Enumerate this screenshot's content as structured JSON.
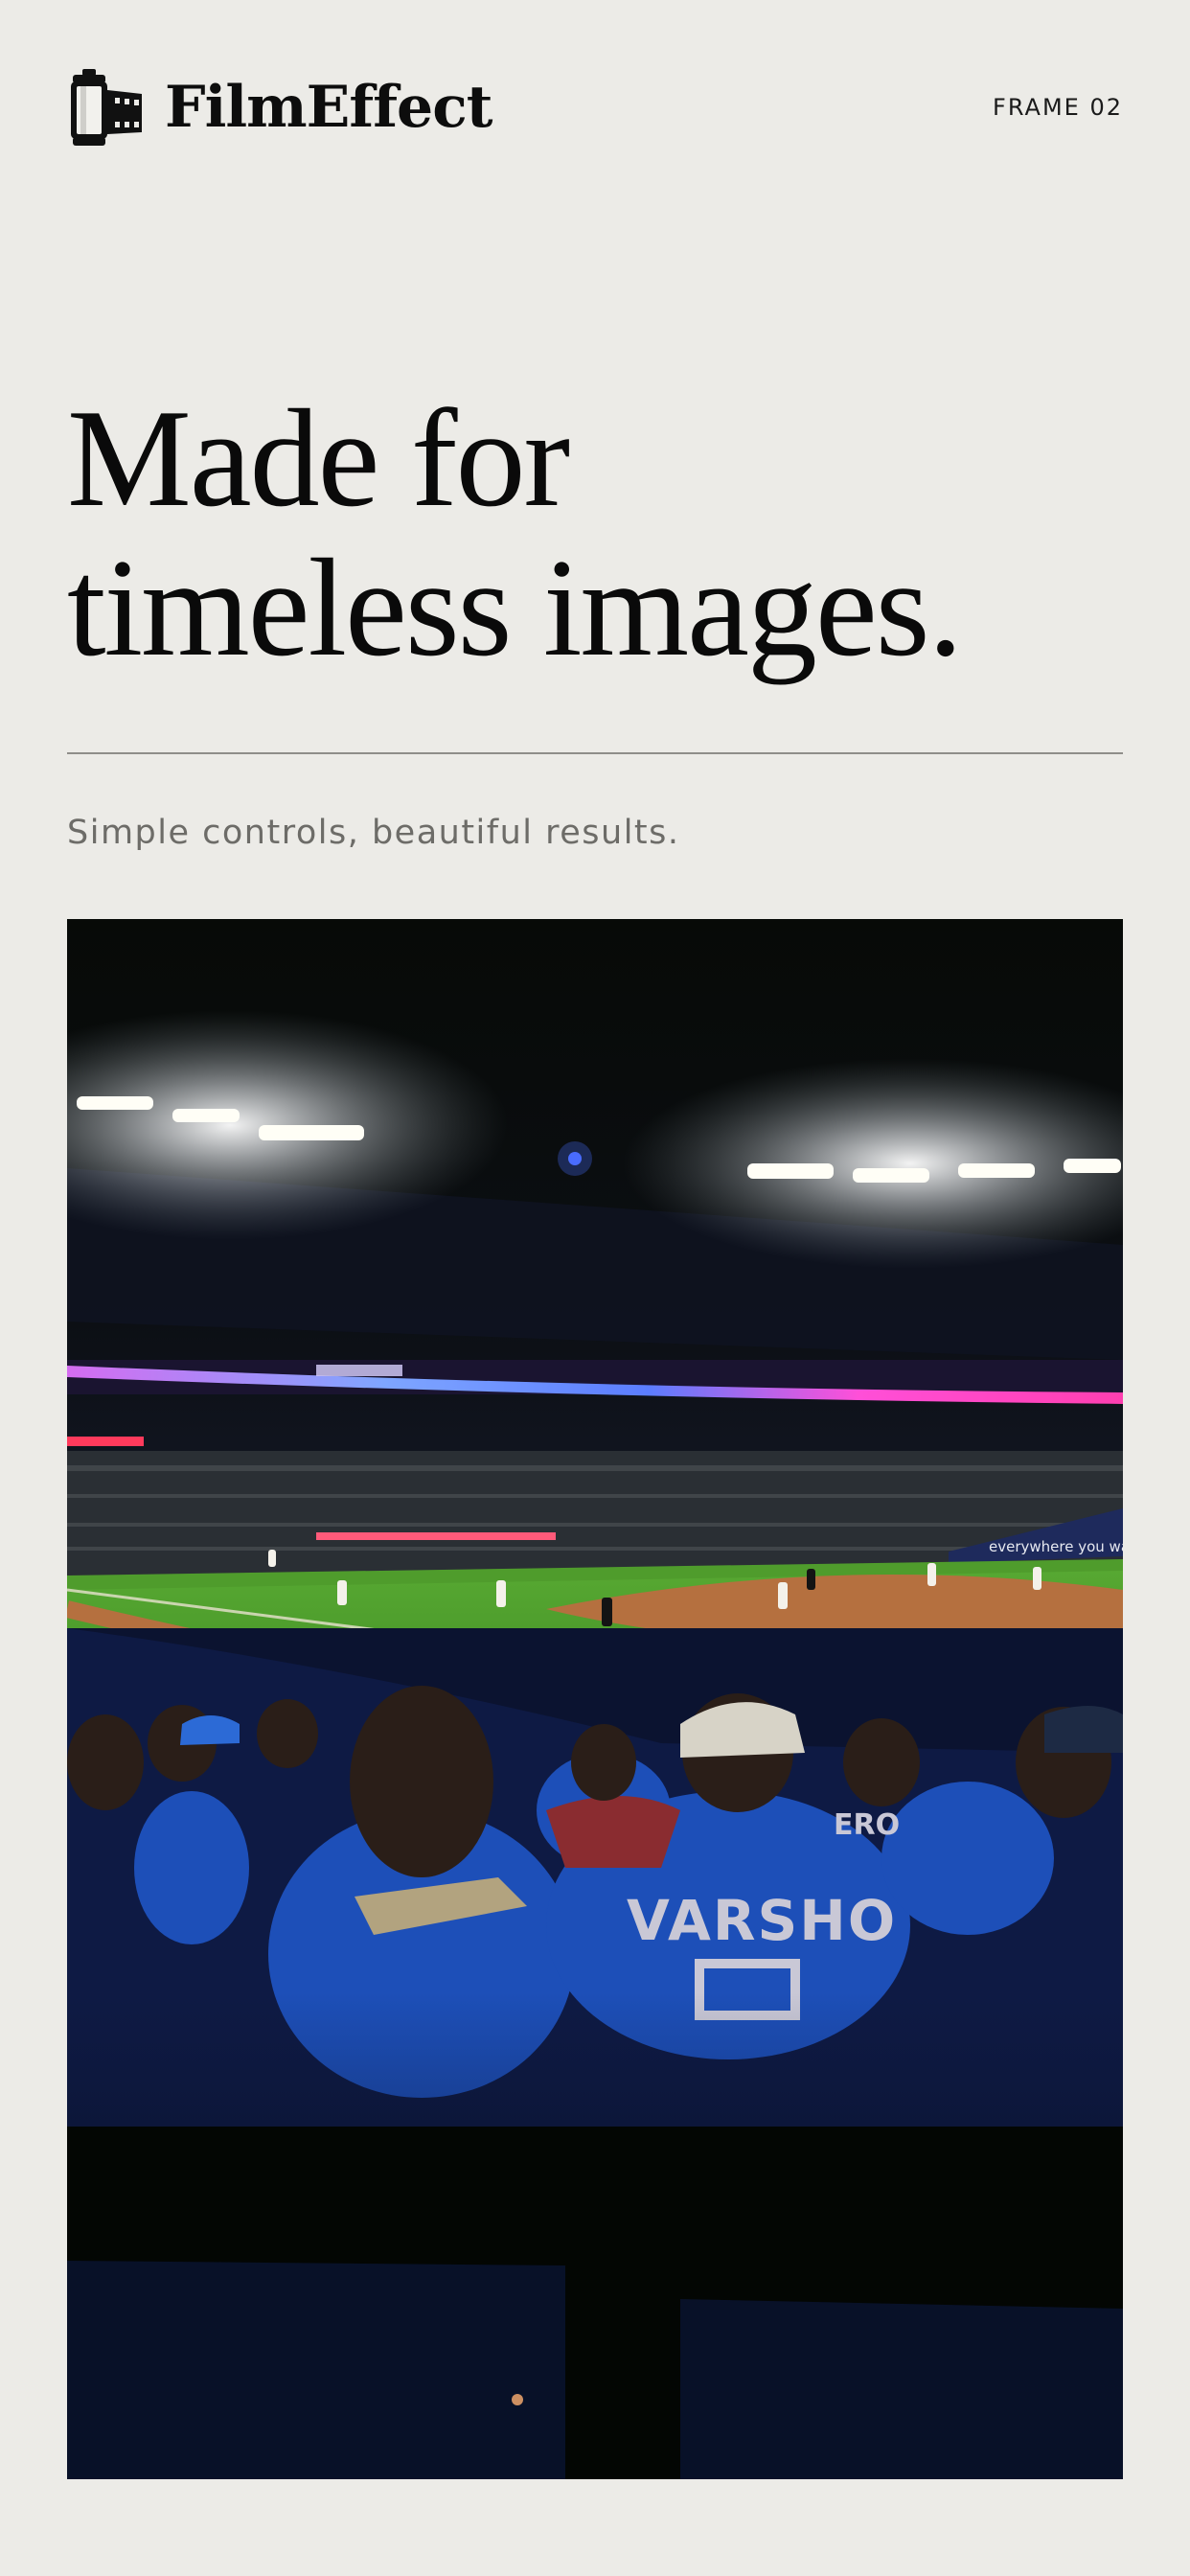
{
  "header": {
    "brand_name": "FilmEffect",
    "logo_icon": "film-canister-icon",
    "frame_label": "FRAME 02"
  },
  "hero": {
    "headline_line1": "Made for",
    "headline_line2": "timeless images.",
    "subtitle": "Simple controls, beautiful results."
  },
  "photo": {
    "jersey_text": "VARSHO",
    "neighbor_jersey_text": "ERO",
    "banner_text": "everywhere you want to be"
  },
  "colors": {
    "background": "#ecebe7",
    "text": "#0d0d0d",
    "subtitle": "#6d6c68",
    "divider": "#8f8e8a"
  }
}
